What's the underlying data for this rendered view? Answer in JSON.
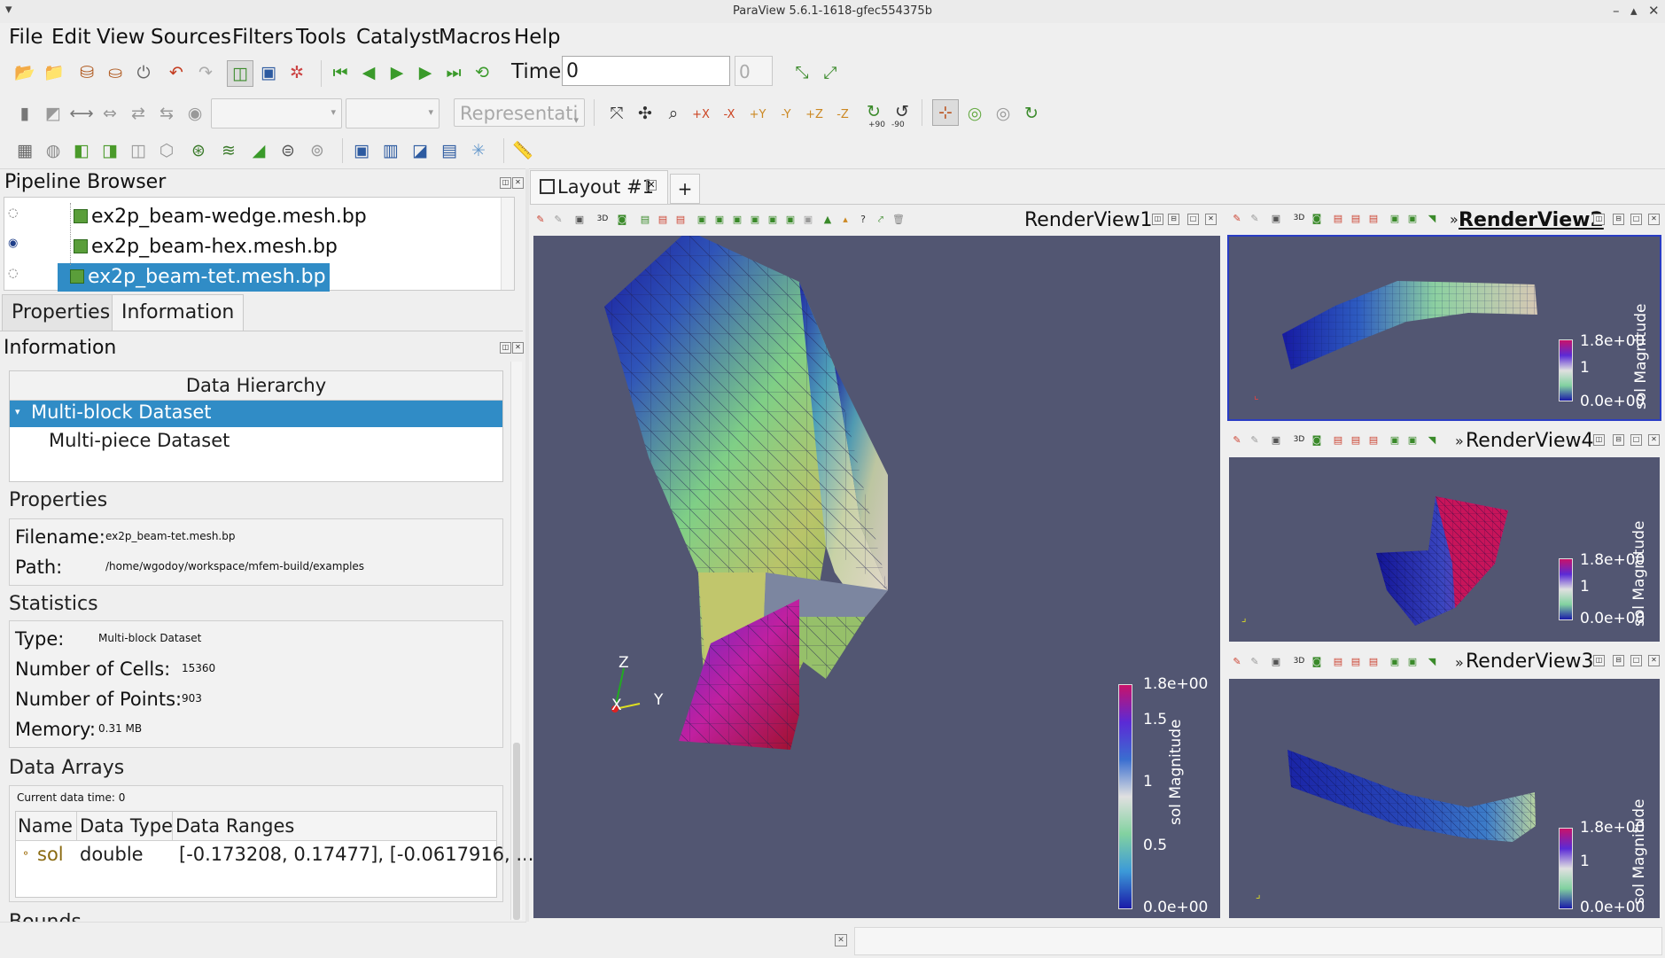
{
  "window": {
    "title": "ParaView 5.6.1-1618-gfec554375b"
  },
  "menu": [
    "File",
    "Edit",
    "View",
    "Sources",
    "Filters",
    "Tools",
    "Catalyst",
    "Macros",
    "Help"
  ],
  "time_toolbar": {
    "label": "Time:",
    "value": "0",
    "index": "0"
  },
  "representation_toolbar": {
    "placeholder": "Representati"
  },
  "view_buttons": {
    "xp": "+X",
    "xm": "-X",
    "yp": "+Y",
    "ym": "-Y",
    "zp": "+Z",
    "zm": "-Z",
    "rot_p": "+90",
    "rot_m": "-90"
  },
  "pipeline": {
    "title": "Pipeline Browser",
    "items": [
      {
        "label": "ex2p_beam-wedge.mesh.bp",
        "visible": false,
        "selected": false
      },
      {
        "label": "ex2p_beam-hex.mesh.bp",
        "visible": true,
        "selected": false
      },
      {
        "label": "ex2p_beam-tet.mesh.bp",
        "visible": false,
        "selected": true
      }
    ]
  },
  "tabs": {
    "properties": "Properties",
    "information": "Information"
  },
  "information": {
    "title": "Information",
    "hierarchy": {
      "header": "Data Hierarchy",
      "root": "Multi-block Dataset",
      "child": "Multi-piece Dataset"
    },
    "properties": {
      "title": "Properties",
      "filename_label": "Filename:",
      "filename": "ex2p_beam-tet.mesh.bp",
      "path_label": "Path:",
      "path": "/home/wgodoy/workspace/mfem-build/examples"
    },
    "statistics": {
      "title": "Statistics",
      "type_label": "Type:",
      "type": "Multi-block Dataset",
      "cells_label": "Number of Cells:",
      "cells": "15360",
      "points_label": "Number of Points:",
      "points": "903",
      "memory_label": "Memory:",
      "memory": "0.31 MB"
    },
    "arrays": {
      "title": "Data Arrays",
      "time": "Current data time: 0",
      "headers": [
        "Name",
        "Data Type",
        "Data Ranges"
      ],
      "rows": [
        {
          "name": "sol",
          "type": "double",
          "ranges": "[-0.173208, 0.17477], [-0.0617916, ..."
        }
      ]
    },
    "cut_title": "Bounds"
  },
  "layout_tab": {
    "label": "Layout #1",
    "add": "+"
  },
  "views": {
    "rv1": {
      "title": "RenderView1",
      "colorbar": {
        "title": "sol Magnitude",
        "ticks": [
          "1.8e+00",
          "1.5",
          "1",
          "0.5",
          "0.0e+00"
        ]
      },
      "axes": {
        "x": "X",
        "y": "Y",
        "z": "Z"
      }
    },
    "rv2": {
      "title": "RenderView2",
      "colorbar": {
        "title": "sol Magnitude",
        "ticks": [
          "1.8e+00",
          "1",
          "0.0e+00"
        ]
      }
    },
    "rv4": {
      "title": "RenderView4",
      "colorbar": {
        "title": "sol Magnitude",
        "ticks": [
          "1.8e+00",
          "1",
          "0.0e+00"
        ]
      }
    },
    "rv3": {
      "title": "RenderView3",
      "colorbar": {
        "title": "sol Magnitude",
        "ticks": [
          "1.8e+00",
          "1",
          "0.0e+00"
        ]
      }
    },
    "view_tb_3d": "3D",
    "more": "»"
  },
  "colors": {
    "view_bg": "#525672",
    "selection": "#308cc6",
    "active_border": "#2a3dc4"
  }
}
